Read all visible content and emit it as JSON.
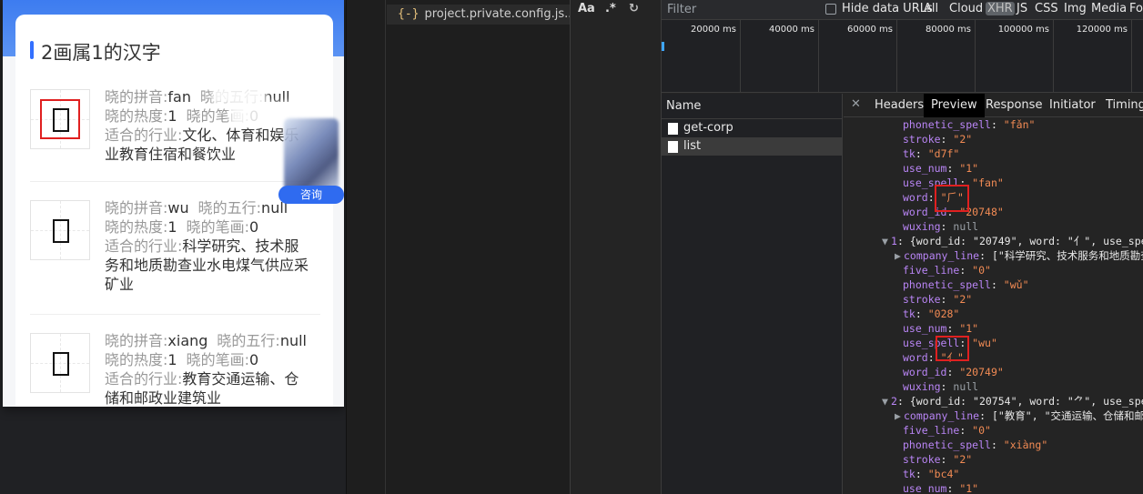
{
  "phone": {
    "title": "2画属1的汉字",
    "label_pinyin": "晓的拼音:",
    "label_wuxing": "晓的五行:",
    "label_hot": "晓的热度:",
    "label_stroke": "晓的笔画:",
    "label_industry": "适合的行业:",
    "items": [
      {
        "pinyin": "fan",
        "wuxing": "null",
        "hot": "1",
        "stroke": "0",
        "industry_l1": "文化、体育和娱乐",
        "industry_l2": "业教育住宿和餐饮业",
        "industry_l3": ""
      },
      {
        "pinyin": "wu",
        "wuxing": "null",
        "hot": "1",
        "stroke": "0",
        "industry_l1": "科学研究、技术服",
        "industry_l2": "务和地质勘查业水电煤气供应采",
        "industry_l3": "矿业"
      },
      {
        "pinyin": "xiang",
        "wuxing": "null",
        "hot": "1",
        "stroke": "0",
        "industry_l1": "教育交通运输、仓",
        "industry_l2": "储和邮政业建筑业",
        "industry_l3": ""
      }
    ],
    "float_button": "咨询"
  },
  "editor": {
    "tab_icon": "{-}",
    "tab_label": "project.private.config.js..."
  },
  "findbar": {
    "case_label": "Aa",
    "regex_label": ".*"
  },
  "devtools": {
    "filter_placeholder": "Filter",
    "hide_data_urls": "Hide data URLs",
    "filter_types": [
      "All",
      "Cloud",
      "XHR",
      "JS",
      "CSS",
      "Img",
      "Media",
      "Fo"
    ],
    "timeline_labels": [
      "20000 ms",
      "40000 ms",
      "60000 ms",
      "80000 ms",
      "100000 ms",
      "120000 ms"
    ],
    "name_header": "Name",
    "requests": [
      "get-corp",
      "list"
    ],
    "tabs": [
      "Headers",
      "Preview",
      "Response",
      "Initiator",
      "Timing"
    ],
    "json_lines": [
      {
        "indent": 0,
        "key": "phonetic_spell",
        "val": "\"fǎn\"",
        "kind": "s"
      },
      {
        "indent": 0,
        "key": "stroke",
        "val": "\"2\"",
        "kind": "s"
      },
      {
        "indent": 0,
        "key": "tk",
        "val": "\"d7f\"",
        "kind": "s"
      },
      {
        "indent": 0,
        "key": "use_num",
        "val": "\"1\"",
        "kind": "s"
      },
      {
        "indent": 0,
        "key": "use_spell",
        "val": "\"fan\"",
        "kind": "s"
      },
      {
        "indent": 0,
        "key": "word",
        "val": "\"⺁\"",
        "kind": "s"
      },
      {
        "indent": 0,
        "key": "word_id",
        "val": "\"20748\"",
        "kind": "s"
      },
      {
        "indent": 0,
        "key": "wuxing",
        "val": "null",
        "kind": "n"
      },
      {
        "indent": -1,
        "key": "1",
        "val": "{word_id: \"20749\", word: \"⺅\", use_spell",
        "kind": "o"
      },
      {
        "indent": 0,
        "key": "company_line",
        "val": "[\"科学研究、技术服务和地质勘查",
        "kind": "a"
      },
      {
        "indent": 0,
        "key": "five_line",
        "val": "\"0\"",
        "kind": "s"
      },
      {
        "indent": 0,
        "key": "phonetic_spell",
        "val": "\"wǔ\"",
        "kind": "s"
      },
      {
        "indent": 0,
        "key": "stroke",
        "val": "\"2\"",
        "kind": "s"
      },
      {
        "indent": 0,
        "key": "tk",
        "val": "\"028\"",
        "kind": "s"
      },
      {
        "indent": 0,
        "key": "use_num",
        "val": "\"1\"",
        "kind": "s"
      },
      {
        "indent": 0,
        "key": "use_spell",
        "val": "\"wu\"",
        "kind": "s"
      },
      {
        "indent": 0,
        "key": "word",
        "val": "\"⺅\"",
        "kind": "s"
      },
      {
        "indent": 0,
        "key": "word_id",
        "val": "\"20749\"",
        "kind": "s"
      },
      {
        "indent": 0,
        "key": "wuxing",
        "val": "null",
        "kind": "n"
      },
      {
        "indent": -1,
        "key": "2",
        "val": "{word_id: \"20754\", word: \"⺈\", use_spell",
        "kind": "o"
      },
      {
        "indent": 0,
        "key": "company_line",
        "val": "[\"教育\", \"交通运输、仓储和邮政",
        "kind": "a"
      },
      {
        "indent": 0,
        "key": "five_line",
        "val": "\"0\"",
        "kind": "s"
      },
      {
        "indent": 0,
        "key": "phonetic_spell",
        "val": "\"xiàng\"",
        "kind": "s"
      },
      {
        "indent": 0,
        "key": "stroke",
        "val": "\"2\"",
        "kind": "s"
      },
      {
        "indent": 0,
        "key": "tk",
        "val": "\"bc4\"",
        "kind": "s"
      },
      {
        "indent": 0,
        "key": "use_num",
        "val": "\"1\"",
        "kind": "s"
      }
    ]
  }
}
